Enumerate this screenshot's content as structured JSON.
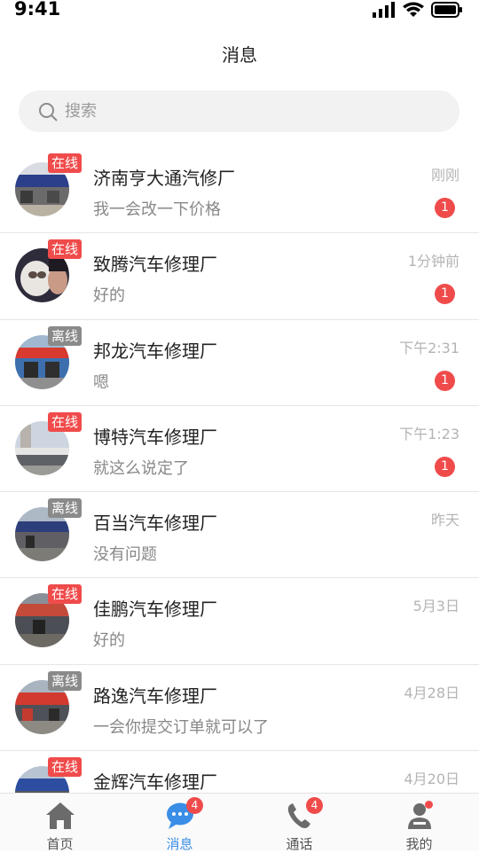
{
  "status_bar": {
    "time": "9:41"
  },
  "header": {
    "title": "消息"
  },
  "search": {
    "placeholder": "搜索"
  },
  "conversations": [
    {
      "name": "济南亨大通汽修厂",
      "message": "我一会改一下价格",
      "time": "刚刚",
      "status": "在线",
      "unread": "1"
    },
    {
      "name": "致腾汽车修理厂",
      "message": "好的",
      "time": "1分钟前",
      "status": "在线",
      "unread": "1"
    },
    {
      "name": "邦龙汽车修理厂",
      "message": "嗯",
      "time": "下午2:31",
      "status": "离线",
      "unread": "1"
    },
    {
      "name": "博特汽车修理厂",
      "message": "就这么说定了",
      "time": "下午1:23",
      "status": "在线",
      "unread": "1"
    },
    {
      "name": "百当汽车修理厂",
      "message": "没有问题",
      "time": "昨天",
      "status": "离线",
      "unread": ""
    },
    {
      "name": "佳鹏汽车修理厂",
      "message": "好的",
      "time": "5月3日",
      "status": "在线",
      "unread": ""
    },
    {
      "name": "路逸汽车修理厂",
      "message": "一会你提交订单就可以了",
      "time": "4月28日",
      "status": "离线",
      "unread": ""
    },
    {
      "name": "金辉汽车修理厂",
      "message": "",
      "time": "4月20日",
      "status": "在线",
      "unread": ""
    }
  ],
  "tabbar": {
    "items": [
      {
        "label": "首页",
        "icon": "home-icon",
        "badge": ""
      },
      {
        "label": "消息",
        "icon": "chat-icon",
        "badge": "4"
      },
      {
        "label": "通话",
        "icon": "phone-icon",
        "badge": "4"
      },
      {
        "label": "我的",
        "icon": "user-icon",
        "badge": ""
      }
    ],
    "active_index": 1
  },
  "colors": {
    "accent": "#3a8ee6",
    "badge": "#f04b4b",
    "online": "#f04b4b",
    "offline": "#8a8a8a"
  }
}
